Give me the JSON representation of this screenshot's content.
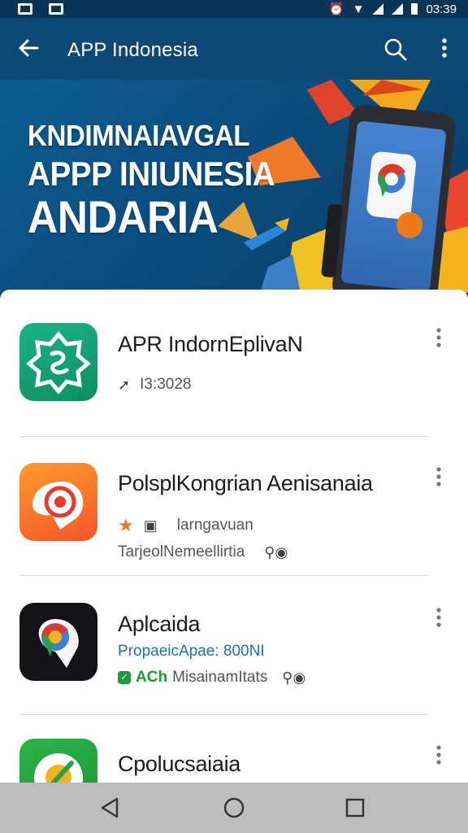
{
  "status_bar": {
    "time": "03:39"
  },
  "app_bar": {
    "title": "APP Indonesia"
  },
  "banner": {
    "line1": "KNDIMNAIAVGAL",
    "line2": "APPP INIUNESIA",
    "line3": "ANDARIA"
  },
  "apps": [
    {
      "name": "APR IndornEplivaN",
      "meta": "I3:3028",
      "icon": "lotus-icon"
    },
    {
      "name": "PolsplKongrian Aenisanaia",
      "meta1": "larngavuan",
      "meta2": "TarjeolNemeellirtia",
      "icon": "target-pin-icon"
    },
    {
      "name": "Aplcaida",
      "meta1": "PropaeicApae: 800NI",
      "meta2_prefix": "ACh",
      "meta2": "MisainamItats",
      "icon": "map-pin-icon"
    },
    {
      "name": "Cpolucsaiaia",
      "icon": "green-app-icon"
    }
  ],
  "colors": {
    "app_bar": "#0e4874",
    "accent_blue": "#1d6fb8",
    "star": "#f07a1a",
    "green": "#1a9b3c"
  }
}
